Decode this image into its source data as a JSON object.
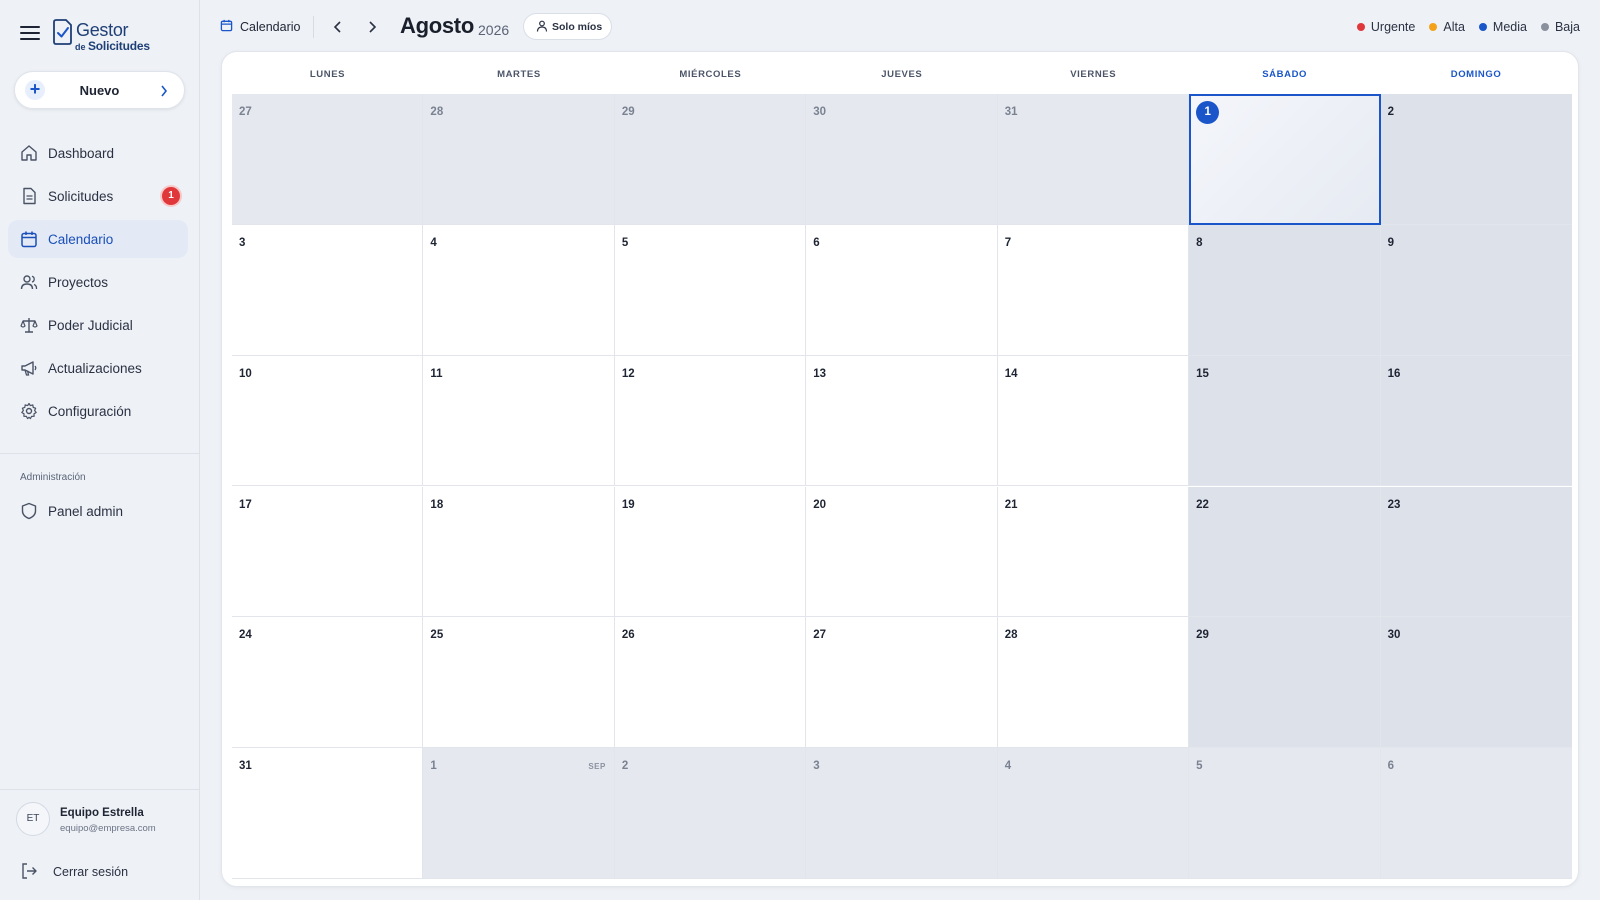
{
  "app": {
    "logo_title": "Gestor",
    "logo_de": "de",
    "logo_subtitle": "Solicitudes"
  },
  "sidebar": {
    "new_button": "Nuevo",
    "items": [
      {
        "label": "Dashboard",
        "icon": "home-icon"
      },
      {
        "label": "Solicitudes",
        "icon": "document-icon",
        "badge": "1"
      },
      {
        "label": "Calendario",
        "icon": "calendar-icon",
        "active": true
      },
      {
        "label": "Proyectos",
        "icon": "users-icon"
      },
      {
        "label": "Poder Judicial",
        "icon": "scale-icon"
      },
      {
        "label": "Actualizaciones",
        "icon": "megaphone-icon"
      },
      {
        "label": "Configuración",
        "icon": "gear-icon"
      }
    ],
    "admin_section": "Administración",
    "admin_items": [
      {
        "label": "Panel admin",
        "icon": "shield-icon"
      }
    ],
    "user": {
      "initials": "ET",
      "name": "Equipo Estrella",
      "email": "equipo@empresa.com"
    },
    "logout": "Cerrar sesión"
  },
  "topbar": {
    "breadcrumb": "Calendario",
    "month": "Agosto",
    "year": "2026",
    "filter_button": "Solo míos",
    "legend": [
      {
        "label": "Urgente",
        "color": "#e0383a"
      },
      {
        "label": "Alta",
        "color": "#f5a21b"
      },
      {
        "label": "Media",
        "color": "#1a56c9"
      },
      {
        "label": "Baja",
        "color": "#8a909c"
      }
    ]
  },
  "calendar": {
    "weekdays": [
      "LUNES",
      "MARTES",
      "MIÉRCOLES",
      "JUEVES",
      "VIERNES",
      "SÁBADO",
      "DOMINGO"
    ],
    "weeks": [
      [
        {
          "d": "27",
          "out": true
        },
        {
          "d": "28",
          "out": true
        },
        {
          "d": "29",
          "out": true
        },
        {
          "d": "30",
          "out": true
        },
        {
          "d": "31",
          "out": true
        },
        {
          "d": "1",
          "today": true
        },
        {
          "d": "2"
        }
      ],
      [
        {
          "d": "3"
        },
        {
          "d": "4"
        },
        {
          "d": "5"
        },
        {
          "d": "6"
        },
        {
          "d": "7"
        },
        {
          "d": "8"
        },
        {
          "d": "9"
        }
      ],
      [
        {
          "d": "10"
        },
        {
          "d": "11"
        },
        {
          "d": "12"
        },
        {
          "d": "13"
        },
        {
          "d": "14"
        },
        {
          "d": "15"
        },
        {
          "d": "16"
        }
      ],
      [
        {
          "d": "17"
        },
        {
          "d": "18"
        },
        {
          "d": "19"
        },
        {
          "d": "20"
        },
        {
          "d": "21"
        },
        {
          "d": "22"
        },
        {
          "d": "23"
        }
      ],
      [
        {
          "d": "24"
        },
        {
          "d": "25"
        },
        {
          "d": "26"
        },
        {
          "d": "27"
        },
        {
          "d": "28"
        },
        {
          "d": "29"
        },
        {
          "d": "30"
        }
      ],
      [
        {
          "d": "31"
        },
        {
          "d": "1",
          "out": true,
          "month": "SEP"
        },
        {
          "d": "2",
          "out": true
        },
        {
          "d": "3",
          "out": true
        },
        {
          "d": "4",
          "out": true
        },
        {
          "d": "5",
          "out": true
        },
        {
          "d": "6",
          "out": true
        }
      ]
    ]
  }
}
